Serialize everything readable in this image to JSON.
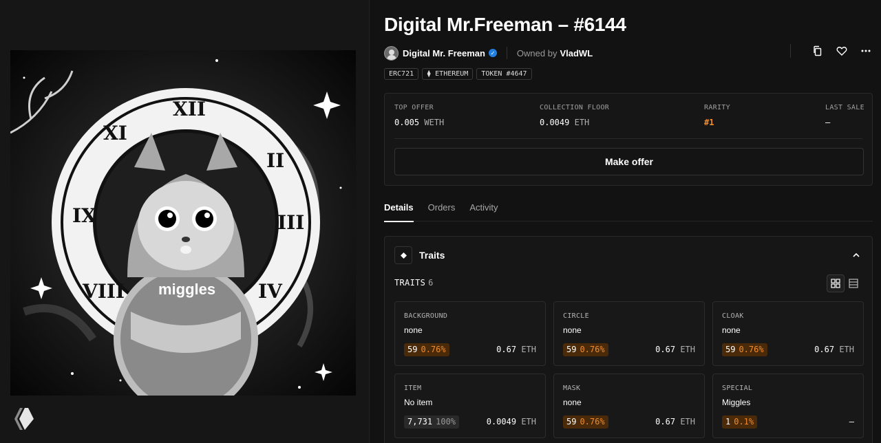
{
  "nft": {
    "title": "Digital Mr.Freeman – #6144",
    "collection": "Digital Mr. Freeman",
    "owned_by_label": "Owned by",
    "owner": "VladWL",
    "artwork_text": "miggles"
  },
  "tags": [
    "ERC721",
    "⧫ ETHEREUM",
    "TOKEN #4647"
  ],
  "stats": {
    "top_offer": {
      "label": "TOP OFFER",
      "value": "0.005",
      "unit": "WETH"
    },
    "collection_floor": {
      "label": "COLLECTION FLOOR",
      "value": "0.0049",
      "unit": "ETH"
    },
    "rarity": {
      "label": "RARITY",
      "value": "#1"
    },
    "last_sale": {
      "label": "LAST SALE",
      "value": "–"
    }
  },
  "make_offer_label": "Make offer",
  "tabs": [
    {
      "label": "Details",
      "active": true
    },
    {
      "label": "Orders",
      "active": false
    },
    {
      "label": "Activity",
      "active": false
    }
  ],
  "traits": {
    "title": "Traits",
    "count_label": "TRAITS",
    "count": "6",
    "items": [
      {
        "type": "BACKGROUND",
        "value": "none",
        "count": "59",
        "pct": "0.76%",
        "price": "0.67",
        "unit": "ETH"
      },
      {
        "type": "CIRCLE",
        "value": "none",
        "count": "59",
        "pct": "0.76%",
        "price": "0.67",
        "unit": "ETH"
      },
      {
        "type": "CLOAK",
        "value": "none",
        "count": "59",
        "pct": "0.76%",
        "price": "0.67",
        "unit": "ETH"
      },
      {
        "type": "ITEM",
        "value": "No item",
        "count": "7,731",
        "pct": "100%",
        "price": "0.0049",
        "unit": "ETH"
      },
      {
        "type": "MASK",
        "value": "none",
        "count": "59",
        "pct": "0.76%",
        "price": "0.67",
        "unit": "ETH"
      },
      {
        "type": "SPECIAL",
        "value": "Miggles",
        "count": "1",
        "pct": "0.1%",
        "price": "–",
        "unit": ""
      }
    ]
  },
  "colors": {
    "background": "#121212",
    "accent_rarity": "#f08c2e",
    "verified": "#2081e2"
  },
  "icons": [
    "copy-icon",
    "heart-icon",
    "more-icon",
    "chevron-up-icon",
    "grid-view-icon",
    "list-view-icon",
    "diamond-icon",
    "verified-icon",
    "hive-logo-icon"
  ]
}
